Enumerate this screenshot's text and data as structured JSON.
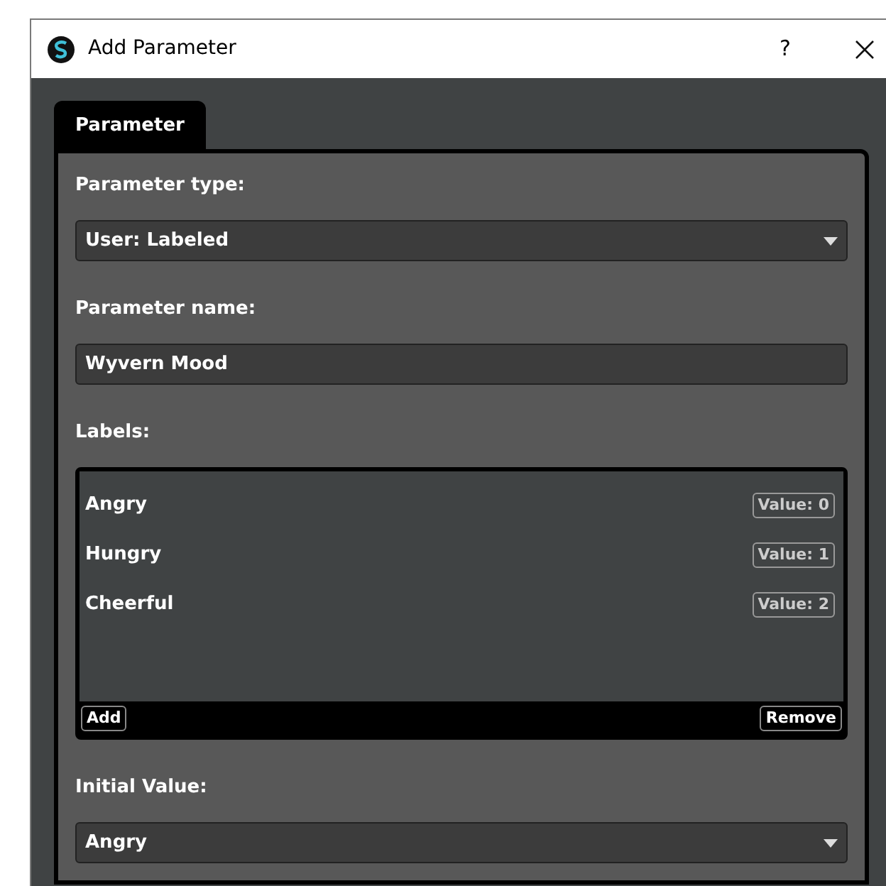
{
  "window": {
    "title": "Add Parameter",
    "help": "?"
  },
  "tabs": [
    {
      "label": "Parameter",
      "selected": true
    }
  ],
  "parameter_type": {
    "label": "Parameter type:",
    "value": "User: Labeled"
  },
  "parameter_name": {
    "label": "Parameter name:",
    "value": "Wyvern Mood"
  },
  "labels": {
    "label": "Labels:",
    "items": [
      {
        "name": "Angry",
        "value": "Value: 0"
      },
      {
        "name": "Hungry",
        "value": "Value: 1"
      },
      {
        "name": "Cheerful",
        "value": "Value: 2"
      }
    ],
    "buttons": [
      "Add",
      "Remove"
    ]
  },
  "initial_value": {
    "label": "Initial Value:",
    "value": "Angry"
  }
}
